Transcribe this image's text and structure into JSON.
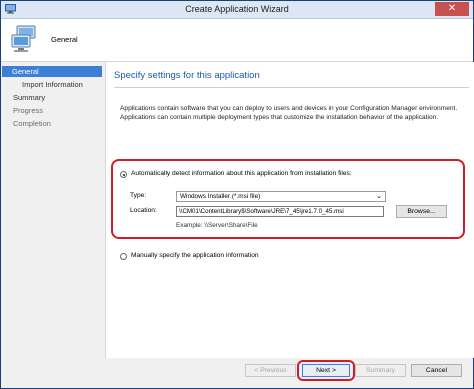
{
  "window": {
    "title": "Create Application Wizard",
    "close_glyph": "✕",
    "icon": "computer-icon"
  },
  "header": {
    "title": "General",
    "icon": "computer-stack-icon"
  },
  "sidebar": {
    "items": [
      {
        "label": "General",
        "state": "active"
      },
      {
        "label": "Import Information",
        "state": "sub"
      },
      {
        "label": "Summary",
        "state": "normal"
      },
      {
        "label": "Progress",
        "state": "disabled"
      },
      {
        "label": "Completion",
        "state": "disabled"
      }
    ]
  },
  "main": {
    "heading": "Specify settings for this application",
    "description": "Applications contain software that you can deploy to users and devices in your Configuration Manager environment. Applications can contain multiple deployment types that customize the installation behavior of the application.",
    "auto_option": {
      "label": "Automatically detect information about this application from installation files:",
      "selected": true
    },
    "type_label": "Type:",
    "type_value": "Windows Installer (*.msi file)",
    "location_label": "Location:",
    "location_value": "\\\\CM01\\ContentLibrary$\\Software\\JRE\\7_45\\jre1.7.0_45.msi",
    "browse_label": "Browse...",
    "example": "Example:  \\\\Server\\Share\\File",
    "manual_option": {
      "label": "Manually specify the application information",
      "selected": false
    }
  },
  "footer": {
    "previous_label": "< Previous",
    "next_label": "Next >",
    "summary_label": "Summary",
    "cancel_label": "Cancel"
  },
  "colors": {
    "accent": "#3d7fd4",
    "heading": "#1e5aa8",
    "highlight": "#d11b2c"
  }
}
